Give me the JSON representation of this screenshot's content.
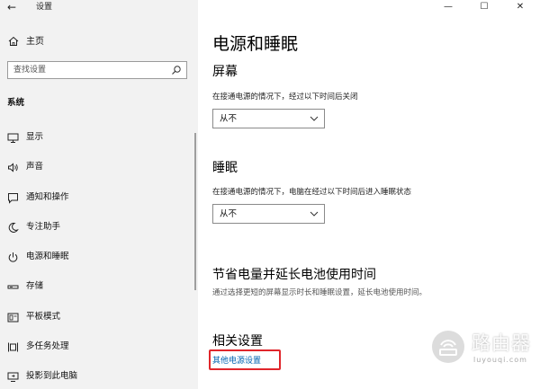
{
  "window": {
    "app_title": "设置",
    "minimize_glyph": "—",
    "maximize_glyph": "☐",
    "close_glyph": "✕",
    "back_glyph": "←"
  },
  "nav": {
    "home_label": "主页",
    "search_placeholder": "查找设置",
    "section_title": "系统",
    "items": [
      {
        "label": "显示",
        "icon": "display-icon"
      },
      {
        "label": "声音",
        "icon": "sound-icon"
      },
      {
        "label": "通知和操作",
        "icon": "notification-icon"
      },
      {
        "label": "专注助手",
        "icon": "moon-icon"
      },
      {
        "label": "电源和睡眠",
        "icon": "power-icon"
      },
      {
        "label": "存储",
        "icon": "storage-icon"
      },
      {
        "label": "平板模式",
        "icon": "tablet-icon"
      },
      {
        "label": "多任务处理",
        "icon": "multitask-icon"
      },
      {
        "label": "投影到此电脑",
        "icon": "project-icon"
      }
    ]
  },
  "content": {
    "page_title": "电源和睡眠",
    "screen": {
      "heading": "屏幕",
      "description": "在接通电源的情况下，经过以下时间后关闭",
      "selected": "从不"
    },
    "sleep": {
      "heading": "睡眠",
      "description": "在接通电源的情况下，电脑在经过以下时间后进入睡眠状态",
      "selected": "从不"
    },
    "battery": {
      "heading": "节省电量并延长电池使用时间",
      "description": "通过选择更短的屏幕显示时长和睡眠设置，延长电池使用时间。"
    },
    "related": {
      "heading": "相关设置",
      "link": "其他电源设置"
    },
    "highlight_color": "#e0262b",
    "link_color": "#0063b1"
  },
  "watermark": {
    "text": "路由器",
    "sub": "luyouqi.com"
  }
}
